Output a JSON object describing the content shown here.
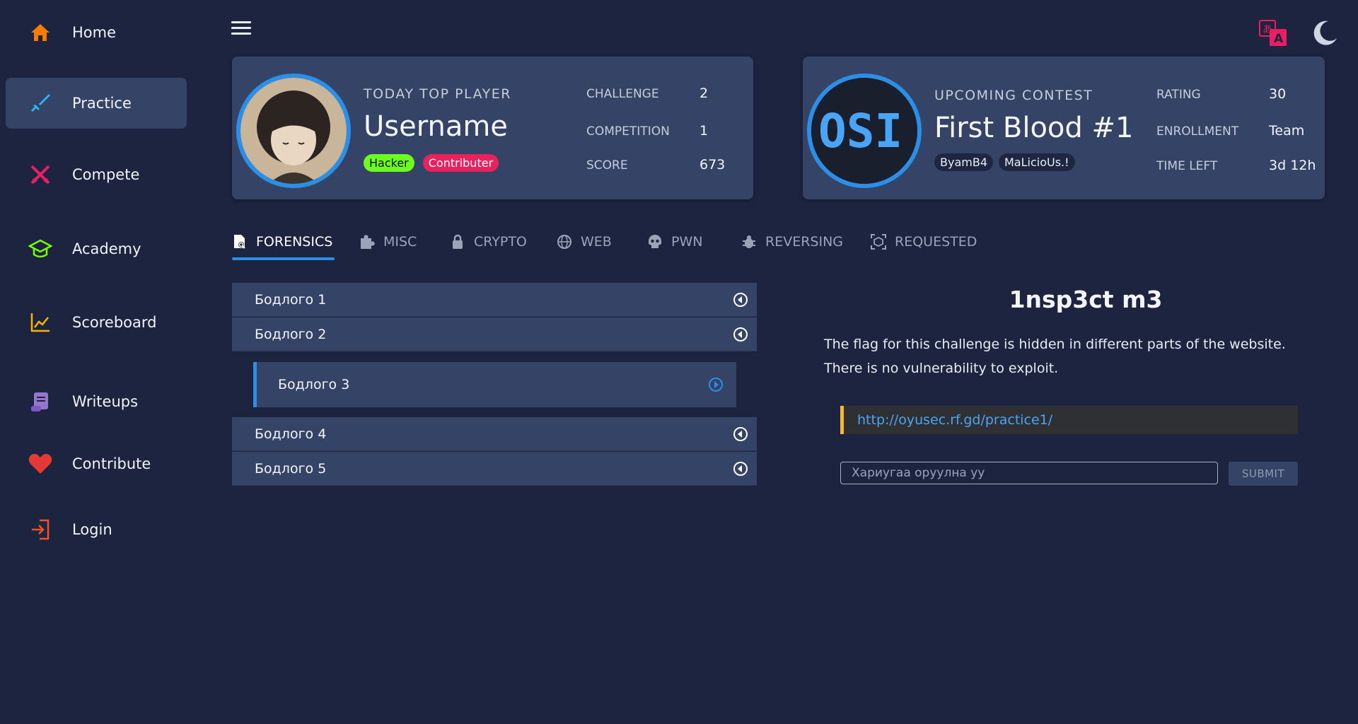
{
  "sidebar": {
    "items": [
      {
        "label": "Home",
        "icon": "home-icon",
        "color": "#f57c00"
      },
      {
        "label": "Practice",
        "icon": "sword-icon",
        "color": "#29b6f6",
        "active": true
      },
      {
        "label": "Compete",
        "icon": "crossed-swords-icon",
        "color": "#e91e63"
      },
      {
        "label": "Academy",
        "icon": "graduation-cap-icon",
        "color": "#76ff03"
      },
      {
        "label": "Scoreboard",
        "icon": "chart-line-icon",
        "color": "#ffb300"
      },
      {
        "label": "Writeups",
        "icon": "scroll-icon",
        "color": "#9575cd"
      },
      {
        "label": "Contribute",
        "icon": "heart-icon",
        "color": "#e53935"
      },
      {
        "label": "Login",
        "icon": "login-icon",
        "color": "#f4511e"
      }
    ]
  },
  "top_player": {
    "kicker": "TODAY TOP PLAYER",
    "username": "Username",
    "badges": [
      "Hacker",
      "Contributer"
    ],
    "stats": [
      {
        "key": "CHALLENGE",
        "value": "2"
      },
      {
        "key": "COMPETITION",
        "value": "1"
      },
      {
        "key": "SCORE",
        "value": "673"
      }
    ]
  },
  "contest": {
    "kicker": "UPCOMING CONTEST",
    "title": "First Blood #1",
    "logo_text": "OSI",
    "badges": [
      "ByamB4",
      "MaLicioUs.!"
    ],
    "stats": [
      {
        "key": "RATING",
        "value": "30"
      },
      {
        "key": "ENROLLMENT",
        "value": "Team"
      },
      {
        "key": "TIME LEFT",
        "value": "3d 12h"
      }
    ]
  },
  "tabs": [
    {
      "label": "FORENSICS",
      "icon": "file-search-icon",
      "active": true
    },
    {
      "label": "MISC",
      "icon": "puzzle-icon"
    },
    {
      "label": "CRYPTO",
      "icon": "lock-icon"
    },
    {
      "label": "WEB",
      "icon": "globe-icon"
    },
    {
      "label": "PWN",
      "icon": "skull-icon"
    },
    {
      "label": "REVERSING",
      "icon": "bug-icon"
    },
    {
      "label": "REQUESTED",
      "icon": "scan-icon"
    }
  ],
  "challenges": [
    {
      "name": "Бодлого 1"
    },
    {
      "name": "Бодлого 2"
    },
    {
      "name": "Бодлого 3",
      "selected": true
    },
    {
      "name": "Бодлого 4"
    },
    {
      "name": "Бодлого 5"
    }
  ],
  "detail": {
    "title": "1nsp3ct m3",
    "description": "The flag for this challenge is hidden in different parts of the website. There is no vulnerability to exploit.",
    "link": "http://oyusec.rf.gd/practice1/",
    "answer_placeholder": "Хариугаа оруулна уу",
    "submit_label": "SUBMIT"
  }
}
